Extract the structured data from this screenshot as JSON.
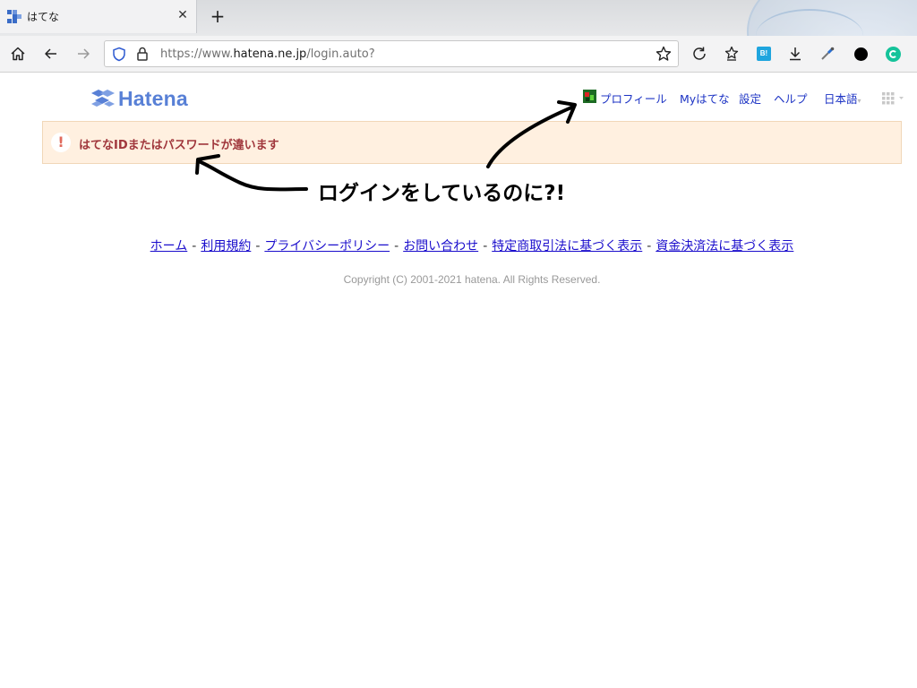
{
  "browser": {
    "tab": {
      "title": "はてな",
      "close_glyph": "✕"
    },
    "new_tab_glyph": "+",
    "url": {
      "prefix": "https://www.",
      "domain": "hatena.ne.jp",
      "path": "/login.auto?"
    },
    "toolbar_icons": [
      "home-icon",
      "back-icon",
      "forward-icon",
      "shield-icon",
      "lock-icon",
      "bookmark-star-icon",
      "reload-icon",
      "collections-icon",
      "hatena-bookmark-extension-icon",
      "download-icon",
      "eyedropper-icon",
      "dark-circle-extension-icon",
      "grammarly-icon"
    ],
    "ext_label_bi": "B!"
  },
  "page": {
    "logo_text": "Hatena",
    "nav": {
      "profile": "プロフィール",
      "my_hatena": "Myはてな",
      "settings": "設定",
      "help": "ヘルプ",
      "language": "日本語"
    },
    "alert": {
      "icon": "!",
      "message": "はてなIDまたはパスワードが違います"
    },
    "annotation": "ログインをしているのに?!",
    "footer": {
      "links": [
        "ホーム",
        "利用規約",
        "プライバシーポリシー",
        "お問い合わせ",
        "特定商取引法に基づく表示",
        "資金決済法に基づく表示"
      ],
      "separator": "-",
      "copyright": "Copyright (C) 2001-2021 hatena. All Rights Reserved."
    },
    "colors": {
      "brand": "#5880d6",
      "link": "#1a0dcc",
      "alert_bg": "#fff0e0",
      "alert_text": "#a0373c"
    }
  }
}
